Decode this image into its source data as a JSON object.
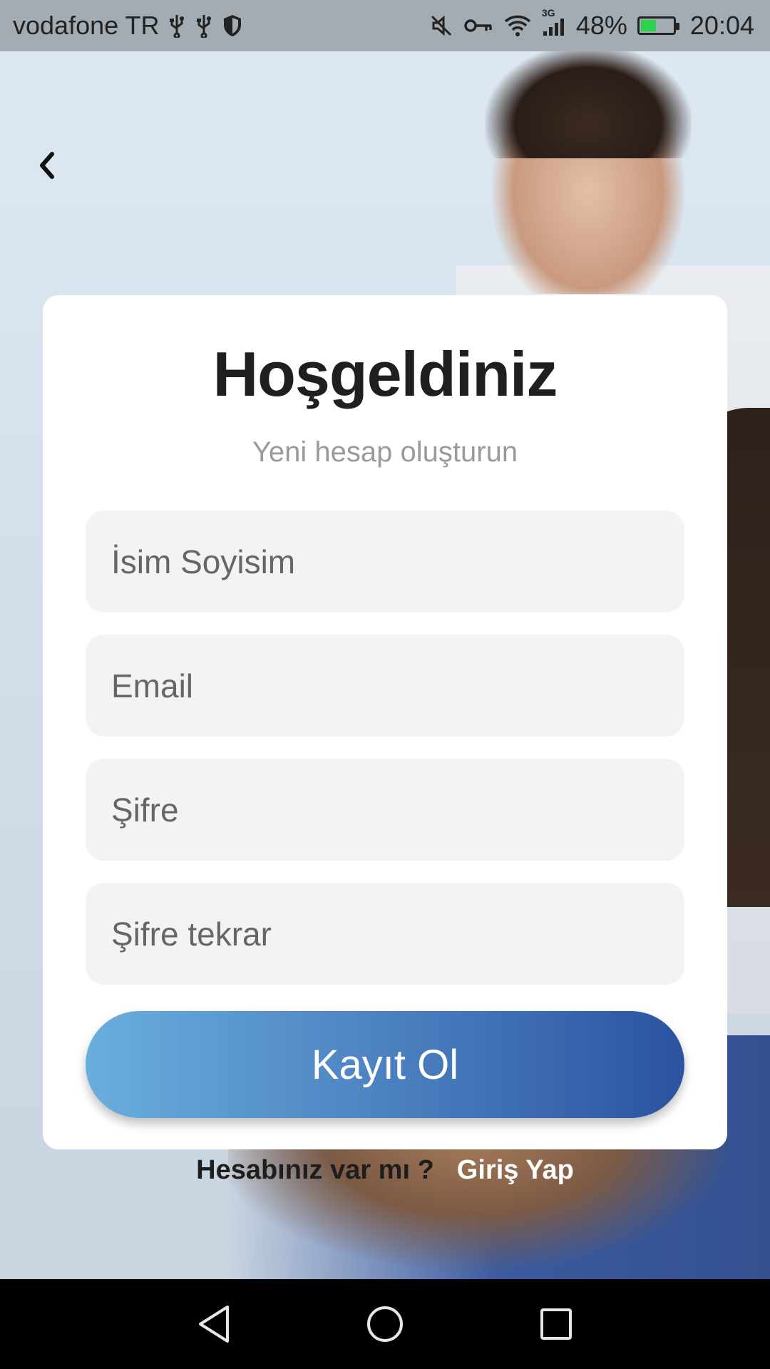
{
  "status_bar": {
    "carrier": "vodafone TR",
    "network": "3G",
    "battery": "48%",
    "time": "20:04",
    "battery_level": 0.48,
    "battery_color": "#2bd44a"
  },
  "icons": {
    "back": "chevron-left-icon",
    "usb": "usb-icon",
    "shield": "shield-icon",
    "mute": "mute-icon",
    "vpn_key": "key-icon",
    "wifi": "wifi-icon",
    "signal": "signal-icon",
    "battery": "battery-icon",
    "nav_back": "triangle-back-icon",
    "nav_home": "circle-home-icon",
    "nav_recents": "square-recents-icon"
  },
  "card": {
    "title": "Hoşgeldiniz",
    "subtitle": "Yeni hesap oluşturun",
    "fields": {
      "name_placeholder": "İsim Soyisim",
      "email_placeholder": "Email",
      "password_placeholder": "Şifre",
      "password_repeat_placeholder": "Şifre tekrar"
    },
    "submit_label": "Kayıt Ol"
  },
  "footer": {
    "question": "Hesabınız var mı ?",
    "login_link": "Giriş Yap"
  },
  "colors": {
    "button_gradient_start": "#6aaedd",
    "button_gradient_end": "#2a53a0",
    "field_bg": "#f3f3f3"
  }
}
